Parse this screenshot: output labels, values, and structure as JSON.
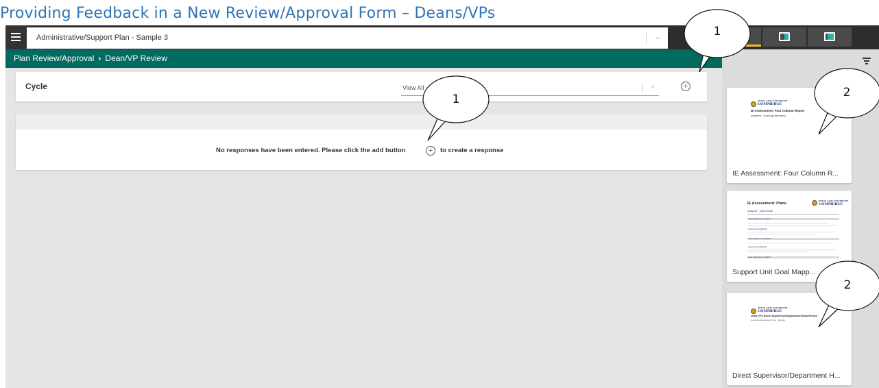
{
  "document": {
    "title": "Providing Feedback in a New Review/Approval Form – Deans/VPs"
  },
  "topbar": {
    "menu_icon": "hamburger-menu-icon",
    "plan_select_value": "Administrative/Support Plan - Sample 3",
    "chevron_icon": "chevron-down-icon",
    "view_tabs": [
      "single-view-icon",
      "split-view-icon",
      "side-panel-view-icon"
    ],
    "active_tab_color": "#f0c419"
  },
  "breadcrumb": {
    "items": [
      "Plan Review/Approval",
      "Dean/VP Review"
    ],
    "separator": "›",
    "bar_color": "#006b5e"
  },
  "cycle": {
    "label": "Cycle",
    "select_value": "View All",
    "add_icon": "add-circle-icon"
  },
  "responses": {
    "empty_message_before": "No responses have been entered. Please click the add button",
    "empty_message_after": "to create a response",
    "add_icon": "add-circle-icon"
  },
  "side_panel": {
    "filter_icon": "filter-icon",
    "reports": [
      {
        "label": "IE Assessment: Four Column R...",
        "thumb_brand": "COMMERCE",
        "thumb_brand_small": "TEXAS A&M UNIVERSITY",
        "thumb_title": "IE Assessment: Four Column Report",
        "thumb_sub": "Academic - Sociology (Bachelor)"
      },
      {
        "label": "Support Unit Goal Mapp...",
        "thumb_brand": "COMMERCE",
        "thumb_brand_small": "TEXAS A&M UNIVERSITY",
        "thumb_title": "IE Assessment: Plans",
        "thumb_sub": "Support - ODD Dean",
        "thumb_sections": [
          "Goal Statement: Goal #1",
          "Assessment Method:",
          "Goal Statement: Goal #2",
          "Assessment Method:",
          "Goal Statement: Goal #3"
        ]
      },
      {
        "label": "Direct Supervisor/Department H...",
        "thumb_brand": "COMMERCE",
        "thumb_brand_small": "TEXAS A&M UNIVERSITY",
        "thumb_title": "Unity VPs Direct Supervisor/Department Head Review",
        "thumb_sub": "Administrative/Support Plan - Sample"
      }
    ]
  },
  "callouts": [
    "1",
    "1",
    "2",
    "2"
  ]
}
